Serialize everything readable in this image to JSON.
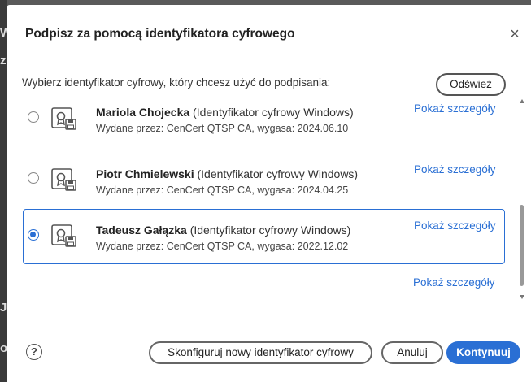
{
  "background": {
    "side_chars": [
      "W",
      "z",
      "J",
      "o"
    ]
  },
  "dialog": {
    "title": "Podpisz za pomocą identyfikatora cyfrowego",
    "close_label": "×",
    "instruction": "Wybierz identyfikator cyfrowy, który chcesz użyć do podpisania:",
    "refresh_label": "Odśwież",
    "ids": [
      {
        "name": "Mariola Chojecka",
        "type": "(Identyfikator cyfrowy Windows)",
        "issued": "Wydane przez: CenCert QTSP CA, wygasa: 2024.06.10",
        "details_label": "Pokaż szczegóły",
        "selected": false
      },
      {
        "name": "Piotr Chmielewski",
        "type": "(Identyfikator cyfrowy Windows)",
        "issued": "Wydane przez: CenCert QTSP CA, wygasa: 2024.04.25",
        "details_label": "Pokaż szczegóły",
        "selected": false
      },
      {
        "name": "Tadeusz Gałązka",
        "type": "(Identyfikator cyfrowy Windows)",
        "issued": "Wydane przez: CenCert QTSP CA, wygasa: 2022.12.02",
        "details_label": "Pokaż szczegóły",
        "selected": true
      }
    ],
    "extra_details_label": "Pokaż szczegóły",
    "help_label": "?",
    "configure_label": "Skonfiguruj nowy identyfikator cyfrowy",
    "cancel_label": "Anuluj",
    "continue_label": "Kontynuuj"
  },
  "colors": {
    "accent": "#2a6fd4"
  }
}
